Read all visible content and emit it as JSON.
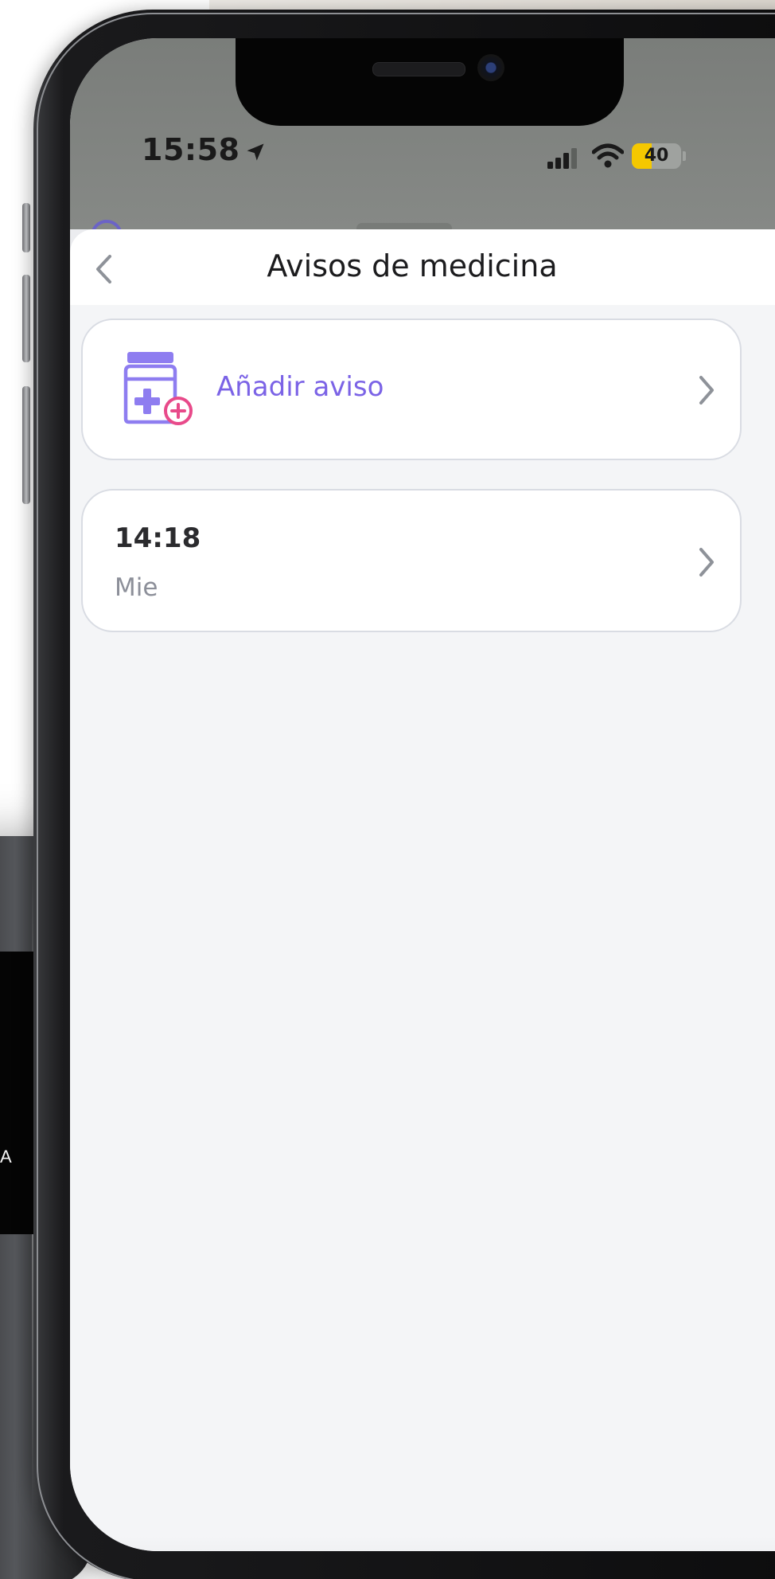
{
  "status_bar": {
    "time": "15:58",
    "battery_level": "40",
    "battery_color": "#f5c800",
    "icons": [
      "location-arrow-icon",
      "cellular-signal-icon",
      "wifi-icon",
      "battery-icon"
    ]
  },
  "nav": {
    "title": "Avisos de medicina",
    "back_icon": "chevron-left-icon"
  },
  "add_card": {
    "label": "Añadir aviso",
    "icon": "medicine-bottle-add-icon",
    "accent_color": "#7b63e6",
    "badge_color": "#e84a8a"
  },
  "alarms": [
    {
      "time": "14:18",
      "days": "Mie"
    }
  ],
  "watch": {
    "screen_text": "A"
  }
}
